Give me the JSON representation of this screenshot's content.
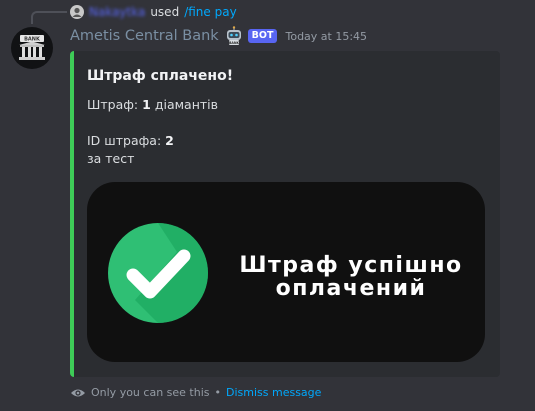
{
  "reply": {
    "username": "Nakaytka",
    "used_text": "used",
    "command": "/fine pay"
  },
  "message": {
    "author": "Ametis Central Bank",
    "bot_badge": "BOT",
    "timestamp": "Today at 15:45",
    "avatar_sign": "BANK",
    "robot_label": "BANK"
  },
  "embed": {
    "accent_color": "#3ecb57",
    "title": "Штраф сплачено!",
    "fine_label": "Штраф:",
    "fine_amount": "1",
    "fine_unit": "діамантів",
    "id_label": "ID штрафа:",
    "id_value": "2",
    "reason": "за тест",
    "banner": {
      "line1": "Штраф успішно",
      "line2": "оплачений",
      "check_color": "#2fbf74"
    }
  },
  "footer": {
    "visibility_text": "Only you can see this",
    "separator": "•",
    "dismiss_label": "Dismiss message"
  },
  "icons": {
    "eye": "eye-icon",
    "check": "checkmark-icon",
    "bank": "bank-icon",
    "robot": "robot-icon"
  }
}
